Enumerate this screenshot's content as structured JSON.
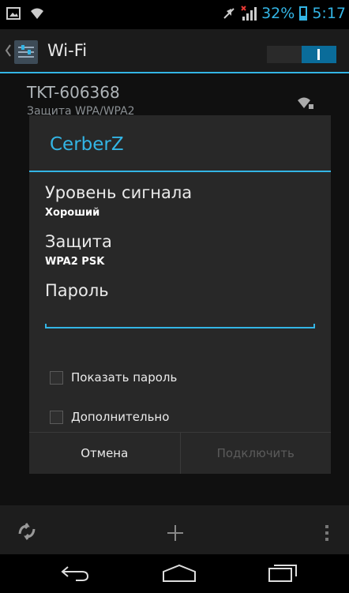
{
  "status_bar": {
    "battery": "32%",
    "time": "5:17",
    "icons": [
      "screenshot-icon",
      "wifi-question-icon",
      "mute-icon",
      "signal-icon",
      "battery-icon"
    ]
  },
  "action_bar": {
    "title": "Wi-Fi",
    "switch_on": true,
    "switch_label": "I"
  },
  "network": {
    "name": "TKT-606368",
    "security": "Защита WPA/WPA2"
  },
  "dialog": {
    "title": "CerberZ",
    "signal_label": "Уровень сигнала",
    "signal_value": "Хороший",
    "security_label": "Защита",
    "security_value": "WPA2 PSK",
    "password_label": "Пароль",
    "password_value": "",
    "show_password_label": "Показать пароль",
    "advanced_label": "Дополнительно",
    "cancel_label": "Отмена",
    "connect_label": "Подключить"
  },
  "colors": {
    "accent": "#33b5e5",
    "dialog_bg": "#282828",
    "disabled_text": "#5b5b5b"
  }
}
